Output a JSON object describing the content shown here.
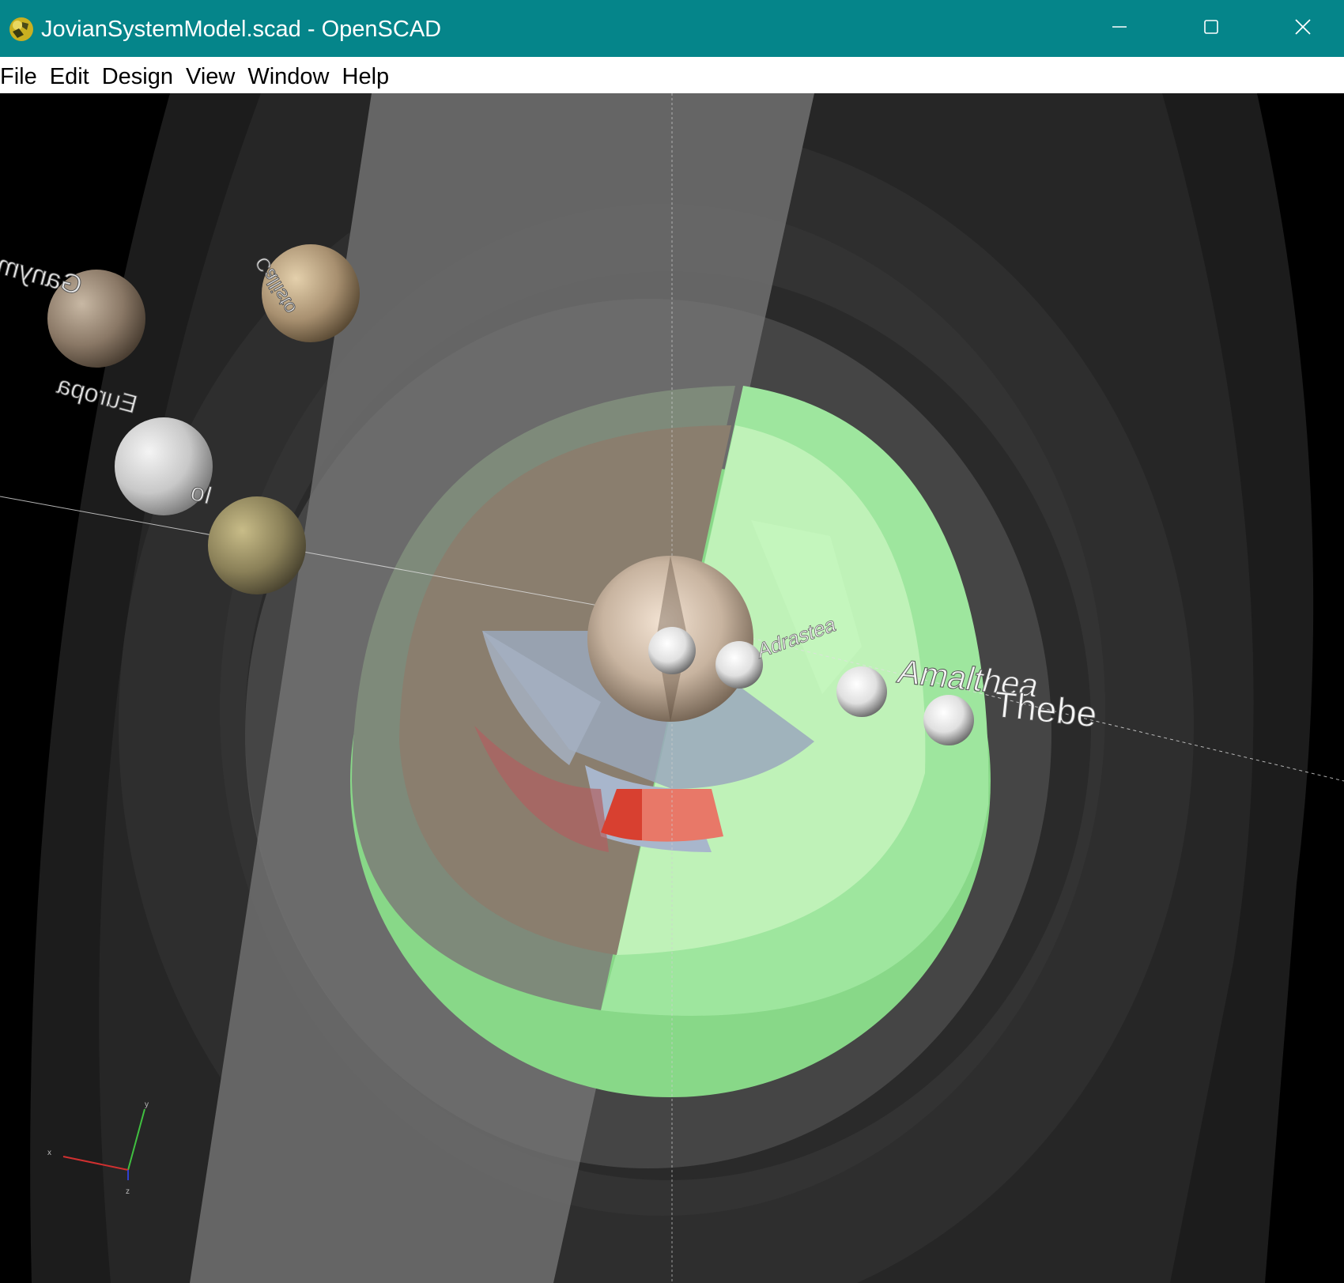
{
  "window": {
    "title": "JovianSystemModel.scad - OpenSCAD",
    "icon": "openscad-logo-icon",
    "controls": [
      "minimize-icon",
      "maximize-icon",
      "close-icon"
    ]
  },
  "menu": {
    "items": [
      "File",
      "Edit",
      "Design",
      "View",
      "Window",
      "Help"
    ]
  },
  "viewport": {
    "background": "#000000",
    "moon_labels": {
      "ganymede": "Ganymede",
      "callisto": "Callisto",
      "europa": "Europa",
      "io": "Io",
      "adrastea": "Adrastea",
      "amalthea": "Amalthea",
      "thebe": "Thebe"
    },
    "axes": {
      "x": "x",
      "y": "y",
      "z": "z"
    },
    "colors": {
      "ring_outer": "#2a2a2a",
      "ring_band": "#6b6b6b",
      "green_zone": "#a8f0a0",
      "brown_zone": "#8a8070",
      "red_zone": "#e05040",
      "blue_zone": "#a0b0c8"
    }
  }
}
